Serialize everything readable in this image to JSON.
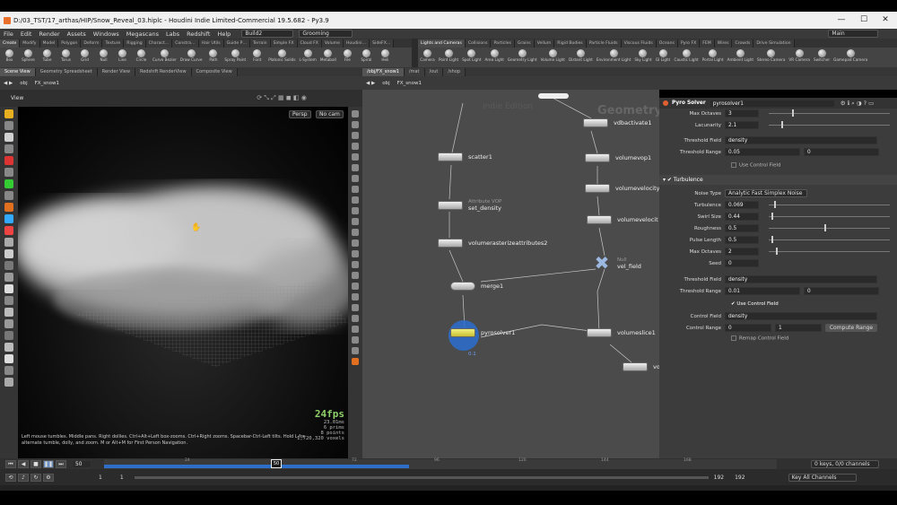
{
  "titlebar": {
    "title": "D:/03_TST/17_arthas/HIP/Snow_Reveal_03.hiplc - Houdini Indie Limited-Commercial 19.5.682 - Py3.9",
    "minimize": "—",
    "maximize": "☐",
    "close": "✕"
  },
  "menubar": {
    "items": [
      "File",
      "Edit",
      "Render",
      "Assets",
      "Windows",
      "Megascans",
      "Labs",
      "Redshift",
      "Help"
    ],
    "desktop": "Build2",
    "context": "Grooming",
    "main_label": "Main"
  },
  "shelf_left": {
    "tabs": [
      "Create",
      "Modify",
      "Model",
      "Polygon",
      "Deform",
      "Texture",
      "Rigging",
      "Charact…",
      "Constra…",
      "Hair Utils",
      "Guide P…",
      "Terrain",
      "Simple FX",
      "Cloud FX",
      "Volume",
      "Houdini…",
      "SideFX…"
    ],
    "tools": [
      "Box",
      "Sphere",
      "Tube",
      "Torus",
      "Grid",
      "Null",
      "Line",
      "Circle",
      "Curve Bezier",
      "Draw Curve",
      "Path",
      "Spray Paint",
      "Font",
      "Platonic Solids",
      "L-System",
      "Metaball",
      "File",
      "Spiral",
      "Heli"
    ]
  },
  "shelf_right": {
    "tabs": [
      "Lights and Cameras",
      "Collisions",
      "Particles",
      "Grains",
      "Vellum",
      "Rigid Bodies",
      "Particle Fluids",
      "Viscous Fluids",
      "Oceans",
      "Pyro FX",
      "FEM",
      "Wires",
      "Crowds",
      "Drive Simulation"
    ],
    "tools": [
      "Camera",
      "Point Light",
      "Spot Light",
      "Area Light",
      "Geometry Light",
      "Volume Light",
      "Distant Light",
      "Environment Light",
      "Sky Light",
      "GI Light",
      "Caustic Light",
      "Portal Light",
      "Ambient Light",
      "Stereo Camera",
      "VR Camera",
      "Switcher",
      "Gamepad Camera"
    ]
  },
  "pane_tabs_left": [
    "Scene View",
    "Geometry Spreadsheet",
    "Render View",
    "Redshift RenderView",
    "Composite View"
  ],
  "pane_tabs_right": [
    "/obj/FX_snow1",
    "/mat",
    "/out",
    "/shop"
  ],
  "path_left": {
    "root": "obj",
    "node": "FX_snow1"
  },
  "path_right": {
    "root": "obj",
    "node": "FX_snow1"
  },
  "viewport": {
    "title": "View",
    "persp": "Persp",
    "cam": "No cam",
    "fps": "24fps",
    "time": "23.01ms",
    "prims": "6  prims",
    "points": "8  points",
    "voxels": "1,720,320  voxels",
    "help": "Left mouse tumbles. Middle pans. Right dollies. Ctrl+Alt+Left box-zooms. Ctrl+Right zooms. Spacebar-Ctrl-Left tilts. Hold L for alternate tumble, dolly, and zoom.    M or Alt+M for First Person Navigation."
  },
  "network": {
    "watermark_left": "Indie Edition",
    "watermark_right": "Geometry",
    "nodes_left": [
      {
        "name": "scatter1",
        "sub": ""
      },
      {
        "name": "set_density",
        "sub": "Attribute VOP"
      },
      {
        "name": "volumerasterizeattributes2",
        "sub": ""
      },
      {
        "name": "merge1",
        "sub": ""
      },
      {
        "name": "pyrosolver1",
        "sub": ""
      }
    ],
    "nodes_right": [
      {
        "name": "vdbactivate1",
        "sub": ""
      },
      {
        "name": "volumevop1",
        "sub": ""
      },
      {
        "name": "volumevelocity",
        "sub": ""
      },
      {
        "name": "volumevelocit",
        "sub": ""
      },
      {
        "name": "vel_field",
        "sub": "Null"
      },
      {
        "name": "volumeslice1",
        "sub": ""
      },
      {
        "name": "volumetrail1",
        "sub": ""
      }
    ],
    "pyro_badge": "0.1"
  },
  "params": {
    "op_type": "Pyro Solver",
    "op_name": "pyrosolver1",
    "rows_top": [
      {
        "label": "Max Octaves",
        "value": "3"
      },
      {
        "label": "Lacunarity",
        "value": "2.1"
      },
      {
        "label": "Threshold Field",
        "value": "density"
      },
      {
        "label": "Threshold Range",
        "value": "0.05",
        "value2": "0"
      }
    ],
    "use_control_field_1": "Use Control Field",
    "section": "Turbulence",
    "noise_type_label": "Noise Type",
    "noise_type": "Analytic Fast Simplex Noise",
    "rows_turb": [
      {
        "label": "Turbulence",
        "value": "0.069"
      },
      {
        "label": "Swirl Size",
        "value": "0.44"
      },
      {
        "label": "Roughness",
        "value": "0.5"
      },
      {
        "label": "Pulse Length",
        "value": "0.5"
      },
      {
        "label": "Max Octaves",
        "value": "2"
      },
      {
        "label": "Seed",
        "value": "0"
      }
    ],
    "threshold_field_label": "Threshold Field",
    "threshold_field": "density",
    "threshold_range_label": "Threshold Range",
    "threshold_range": "0.01",
    "threshold_range2": "0",
    "use_control_field_2": "Use Control Field",
    "control_field_label": "Control Field",
    "control_field": "density",
    "control_range_label": "Control Range",
    "control_range": "0",
    "control_range2": "1",
    "compute_range": "Compute Range",
    "remap": "Remap Control Field"
  },
  "timeline": {
    "frame": "50",
    "cur_marker": "50",
    "ticks": [
      "24",
      "72",
      "96",
      "120",
      "144",
      "168"
    ],
    "keys_label": "0 keys, 0/0 channels",
    "channels": "Key All Channels",
    "start": "1",
    "start2": "1",
    "end": "192",
    "end2": "192"
  }
}
